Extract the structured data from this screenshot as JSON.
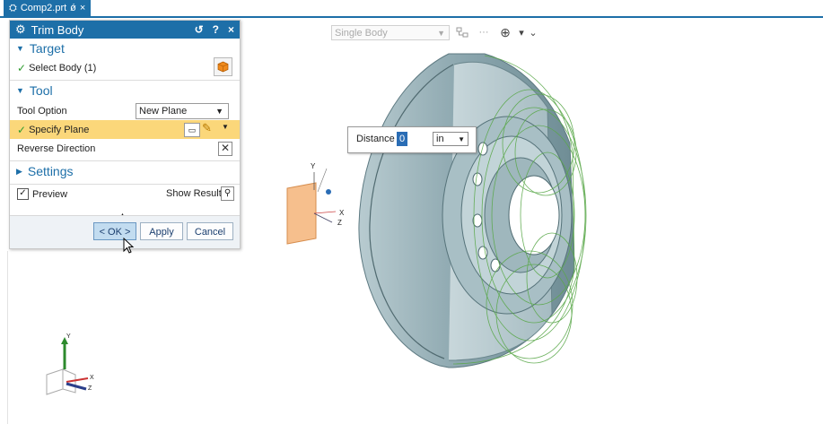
{
  "tab": {
    "title": "Comp2.prt",
    "pin": "ǿ",
    "close": "×"
  },
  "graphics_toolbar": {
    "filter": "Single Body",
    "more": "···",
    "snap_arrow": "▾"
  },
  "dialog": {
    "title": "Trim Body",
    "reset": "↺",
    "help": "?",
    "close": "×",
    "target": {
      "header": "Target",
      "select_body": "Select Body (1)"
    },
    "tool": {
      "header": "Tool",
      "tool_option_label": "Tool Option",
      "tool_option_value": "New Plane",
      "specify_plane": "Specify Plane",
      "reverse_direction": "Reverse Direction"
    },
    "settings": {
      "header": "Settings"
    },
    "preview": {
      "label": "Preview",
      "checked": true
    },
    "show_result": "Show Result",
    "buttons": {
      "ok": "< OK >",
      "apply": "Apply",
      "cancel": "Cancel"
    }
  },
  "distance_popup": {
    "label": "Distance",
    "value": "0",
    "unit": "in"
  },
  "triads": {
    "plane": {
      "x": "X",
      "y": "Y",
      "z": "Z"
    },
    "view": {
      "x": "X",
      "y": "Y",
      "z": "Z"
    }
  },
  "colors": {
    "accent": "#1d6fa8",
    "highlight": "#fbd77a",
    "plane": "#f5b57a",
    "wire": "#5aa84a",
    "part": "#9fb8bf"
  },
  "icons": [
    "settings-gear-icon",
    "cube-icon",
    "plane-icon",
    "brush-icon",
    "crosshair-icon",
    "cursor-icon"
  ]
}
